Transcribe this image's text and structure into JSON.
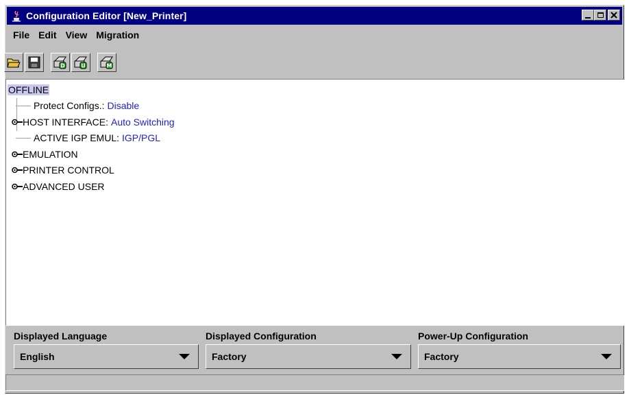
{
  "window": {
    "title": "Configuration Editor [New_Printer]"
  },
  "menu": [
    "File",
    "Edit",
    "View",
    "Migration"
  ],
  "toolbar": {
    "buttons": [
      {
        "icon": "open-folder-icon"
      },
      {
        "icon": "save-icon"
      },
      {
        "icon": "printer-download-icon",
        "badge": "D"
      },
      {
        "icon": "printer-upload-icon",
        "badge": "U"
      },
      {
        "icon": "printer-migrate-icon",
        "badge": "M"
      }
    ]
  },
  "tree": {
    "root": "OFFLINE",
    "nodes": [
      {
        "label": "Protect Configs.:",
        "value": "Disable",
        "expandable": false
      },
      {
        "label": "HOST INTERFACE:",
        "value": "Auto Switching",
        "expandable": true
      },
      {
        "label": "ACTIVE IGP EMUL:",
        "value": "IGP/PGL",
        "expandable": false
      },
      {
        "label": "EMULATION",
        "value": "",
        "expandable": true
      },
      {
        "label": "PRINTER CONTROL",
        "value": "",
        "expandable": true
      },
      {
        "label": "ADVANCED USER",
        "value": "",
        "expandable": true
      }
    ]
  },
  "selectors": {
    "language": {
      "label": "Displayed Language",
      "value": "English"
    },
    "displayed_config": {
      "label": "Displayed Configuration",
      "value": "Factory"
    },
    "powerup_config": {
      "label": "Power-Up Configuration",
      "value": "Factory"
    }
  },
  "colors": {
    "title_bar": "#000080",
    "value_text": "#2020d0",
    "selection": "#c8c8f0"
  }
}
